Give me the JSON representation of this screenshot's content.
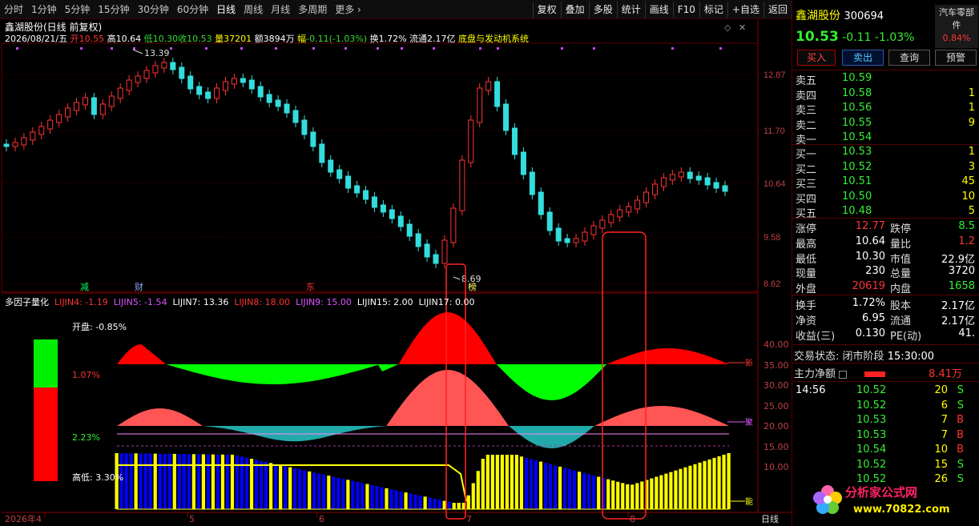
{
  "toolbar": {
    "periods": [
      "分时",
      "1分钟",
      "5分钟",
      "15分钟",
      "30分钟",
      "60分钟",
      "日线",
      "周线",
      "月线",
      "多周期",
      "更多"
    ],
    "more_arrow": "›",
    "tools": [
      "复权",
      "叠加",
      "多股",
      "统计",
      "画线",
      "F10",
      "标记",
      "+自选",
      "返回"
    ]
  },
  "info": {
    "title": "鑫湖股份(日线 前复权)",
    "date": "2026/08/21/五",
    "open_label": "开",
    "open": "10.55",
    "high_label": "高",
    "high": "10.64",
    "low_label": "低",
    "low": "10.30",
    "close_label": "收",
    "close": "10.53",
    "vol_label": "量",
    "vol": "37201",
    "amt_label": "额",
    "amt": "3894万",
    "chg_label": "幅",
    "chg": "-0.11(-1.03%)",
    "turn_label": "换",
    "turn": "1.72%",
    "float_label": "流通",
    "float": "2.17亿",
    "system": "底盘与发动机系统"
  },
  "price_axis": [
    "12.87",
    "11.70",
    "10.64",
    "9.58",
    "8.62"
  ],
  "annot_high": "13.39",
  "annot_low": "8.69",
  "event_marks": [
    "减",
    "财",
    "东",
    "榜"
  ],
  "sub_chart": {
    "title": "多因子量化",
    "lijin4": "LIJIN4: -1.19",
    "lijin5": "LIJIN5: -1.54",
    "lijin7": "LIJIN7: 13.36",
    "lijin8": "LIJIN8: 18.00",
    "lijin9": "LIJIN9: 15.00",
    "lijin15": "LIJIN15: 2.00",
    "lijin17": "LIJIN17: 0.00",
    "open_text": "开盘: -0.85%",
    "mid_pct": "1.07%",
    "low_pct": "2.23%",
    "hl_text": "高低: 3.30%",
    "axis": [
      "40.00",
      "35.00",
      "30.00",
      "25.00",
      "20.00",
      "15.00",
      "10.00"
    ],
    "tag_fun": "新",
    "tag_ju": "聚",
    "tag_yu": "能"
  },
  "date_axis": [
    "2026年4",
    "5",
    "6",
    "7",
    "8"
  ],
  "date_axis_unit": "日线",
  "quote": {
    "name": "鑫湖股份",
    "code": "300694",
    "price": "10.53",
    "chg": "-0.11",
    "chg_pct": "-1.03%",
    "industry": "汽车零部件",
    "industry_pct": "0.84%",
    "buttons": [
      "买入",
      "卖出",
      "查询",
      "预警"
    ],
    "asks": [
      {
        "label": "卖五",
        "price": "10.59",
        "vol": ""
      },
      {
        "label": "卖四",
        "price": "10.58",
        "vol": "1"
      },
      {
        "label": "卖三",
        "price": "10.56",
        "vol": "1"
      },
      {
        "label": "卖二",
        "price": "10.55",
        "vol": "9"
      },
      {
        "label": "卖一",
        "price": "10.54",
        "vol": ""
      }
    ],
    "bids": [
      {
        "label": "买一",
        "price": "10.53",
        "vol": "1"
      },
      {
        "label": "买二",
        "price": "10.52",
        "vol": "3"
      },
      {
        "label": "买三",
        "price": "10.51",
        "vol": "45"
      },
      {
        "label": "买四",
        "price": "10.50",
        "vol": "10"
      },
      {
        "label": "买五",
        "price": "10.48",
        "vol": "5"
      }
    ],
    "stats": [
      {
        "l1": "涨停",
        "v1": "12.77",
        "l2": "跌停",
        "v2": "8.5"
      },
      {
        "l1": "最高",
        "v1": "10.64",
        "l2": "量比",
        "v2": "1.2"
      },
      {
        "l1": "最低",
        "v1": "10.30",
        "l2": "市值",
        "v2": "22.9亿"
      },
      {
        "l1": "现量",
        "v1": "230",
        "l2": "总量",
        "v2": "3720"
      },
      {
        "l1": "外盘",
        "v1": "20619",
        "l2": "内盘",
        "v2": "1658"
      }
    ],
    "stats2": [
      {
        "l1": "换手",
        "v1": "1.72%",
        "l2": "股本",
        "v2": "2.17亿"
      },
      {
        "l1": "净资",
        "v1": "6.95",
        "l2": "流通",
        "v2": "2.17亿"
      },
      {
        "l1": "收益(三)",
        "v1": "0.130",
        "l2": "PE(动)",
        "v2": "41."
      }
    ],
    "trade_status_label": "交易状态:",
    "trade_status": "闭市阶段",
    "trade_time": "15:30:00",
    "main_flow_label": "主力净额",
    "main_flow": "8.41万",
    "ticks_time": "14:56",
    "ticks": [
      {
        "price": "10.52",
        "vol": "20",
        "side": "S"
      },
      {
        "price": "10.52",
        "vol": "6",
        "side": "S"
      },
      {
        "price": "10.53",
        "vol": "7",
        "side": "B"
      },
      {
        "price": "10.53",
        "vol": "7",
        "side": "B"
      },
      {
        "price": "10.54",
        "vol": "10",
        "side": "B"
      },
      {
        "price": "10.52",
        "vol": "15",
        "side": "S"
      },
      {
        "price": "10.52",
        "vol": "26",
        "side": "S"
      }
    ],
    "logo_text": "分析家公式网",
    "logo_url": "www.70822.com"
  },
  "colors": {
    "up": "#ff3333",
    "down": "#33dddd",
    "green": "#00ee00",
    "red": "#ff0000",
    "yellow": "#ffff00",
    "blue": "#0000ff"
  }
}
